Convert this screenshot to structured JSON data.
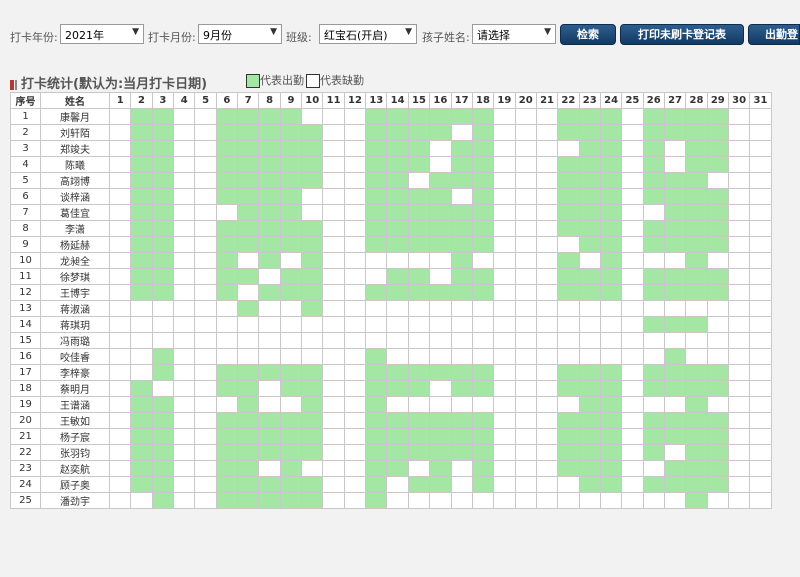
{
  "filters": {
    "year_label": "打卡年份:",
    "year_value": "2021年",
    "month_label": "打卡月份:",
    "month_value": "9月份",
    "class_label": "班级:",
    "class_value": "红宝石(开启)",
    "child_label": "孩子姓名:",
    "child_value": "请选择"
  },
  "buttons": {
    "search": "检索",
    "print": "打印未刷卡登记表",
    "attendance": "出勤登"
  },
  "section": {
    "title": "打卡统计(默认为:当月打卡日期)",
    "legend_present": "代表出勤",
    "legend_absent": "代表缺勤"
  },
  "colors": {
    "present": "#a4e6a4",
    "button": "#1f4a76",
    "title_mark": "#b03a3a"
  },
  "table": {
    "col_index": "序号",
    "col_name": "姓名",
    "days": 31,
    "rows": [
      {
        "no": "1",
        "name": "康馨月",
        "present": [
          2,
          3,
          6,
          7,
          8,
          9,
          13,
          14,
          15,
          16,
          17,
          18,
          22,
          23,
          24,
          26,
          27,
          28,
          29
        ]
      },
      {
        "no": "2",
        "name": "刘轩陌",
        "present": [
          2,
          3,
          6,
          7,
          8,
          9,
          10,
          13,
          14,
          15,
          16,
          18,
          22,
          23,
          24,
          26,
          27,
          28,
          29
        ]
      },
      {
        "no": "3",
        "name": "郑竣夫",
        "present": [
          2,
          3,
          6,
          7,
          8,
          9,
          10,
          13,
          14,
          15,
          17,
          18,
          23,
          24,
          26,
          28,
          29
        ]
      },
      {
        "no": "4",
        "name": "陈曦",
        "present": [
          2,
          3,
          6,
          7,
          8,
          9,
          10,
          13,
          14,
          15,
          17,
          18,
          22,
          23,
          24,
          26,
          28,
          29
        ]
      },
      {
        "no": "5",
        "name": "高翊博",
        "present": [
          2,
          3,
          6,
          7,
          8,
          9,
          10,
          13,
          14,
          16,
          17,
          18,
          22,
          23,
          24,
          26,
          27,
          28
        ]
      },
      {
        "no": "6",
        "name": "谈梓涵",
        "present": [
          2,
          3,
          6,
          7,
          8,
          9,
          13,
          14,
          15,
          16,
          18,
          22,
          23,
          24,
          26,
          27,
          28,
          29
        ]
      },
      {
        "no": "7",
        "name": "葛佳宜",
        "present": [
          2,
          3,
          7,
          8,
          9,
          13,
          14,
          15,
          16,
          17,
          18,
          22,
          23,
          24,
          27,
          28,
          29
        ]
      },
      {
        "no": "8",
        "name": "李潇",
        "present": [
          2,
          3,
          6,
          7,
          8,
          9,
          10,
          13,
          14,
          15,
          16,
          17,
          18,
          22,
          23,
          24,
          26,
          27,
          28,
          29
        ]
      },
      {
        "no": "9",
        "name": "杨延赫",
        "present": [
          2,
          3,
          6,
          7,
          8,
          9,
          10,
          13,
          14,
          15,
          16,
          17,
          18,
          23,
          24,
          26,
          27,
          28,
          29
        ]
      },
      {
        "no": "10",
        "name": "龙昶全",
        "present": [
          2,
          3,
          6,
          8,
          10,
          17,
          22,
          24,
          28
        ]
      },
      {
        "no": "11",
        "name": "徐梦琪",
        "present": [
          2,
          3,
          6,
          7,
          9,
          10,
          14,
          15,
          17,
          18,
          22,
          23,
          24,
          26,
          27,
          28,
          29
        ]
      },
      {
        "no": "12",
        "name": "王博宇",
        "present": [
          2,
          3,
          6,
          8,
          9,
          10,
          13,
          14,
          15,
          16,
          17,
          18,
          22,
          23,
          24,
          26,
          27,
          28,
          29
        ]
      },
      {
        "no": "13",
        "name": "蒋淑涵",
        "present": [
          7,
          10
        ]
      },
      {
        "no": "14",
        "name": "蒋琪玥",
        "present": [
          26,
          27,
          28
        ]
      },
      {
        "no": "15",
        "name": "冯雨璐",
        "present": []
      },
      {
        "no": "16",
        "name": "咬佳睿",
        "present": [
          3,
          13,
          27
        ]
      },
      {
        "no": "17",
        "name": "李梓豪",
        "present": [
          3,
          6,
          7,
          8,
          9,
          10,
          13,
          14,
          15,
          16,
          17,
          18,
          22,
          23,
          24,
          26,
          27,
          28,
          29
        ]
      },
      {
        "no": "18",
        "name": "蔡明月",
        "present": [
          2,
          6,
          7,
          9,
          10,
          13,
          14,
          15,
          17,
          18,
          22,
          23,
          24,
          26,
          27,
          28,
          29
        ]
      },
      {
        "no": "19",
        "name": "王谱涵",
        "present": [
          2,
          3,
          7,
          10,
          13,
          23,
          24,
          28
        ]
      },
      {
        "no": "20",
        "name": "王敏如",
        "present": [
          2,
          3,
          6,
          7,
          8,
          9,
          10,
          13,
          14,
          15,
          16,
          17,
          18,
          22,
          23,
          24,
          26,
          27,
          28,
          29
        ]
      },
      {
        "no": "21",
        "name": "杨子宸",
        "present": [
          2,
          3,
          6,
          7,
          8,
          9,
          10,
          13,
          14,
          15,
          16,
          17,
          18,
          22,
          23,
          24,
          26,
          27,
          28,
          29
        ]
      },
      {
        "no": "22",
        "name": "张羽钧",
        "present": [
          2,
          3,
          6,
          7,
          8,
          9,
          10,
          13,
          14,
          15,
          16,
          17,
          18,
          22,
          23,
          24,
          26,
          28,
          29
        ]
      },
      {
        "no": "23",
        "name": "赵奕航",
        "present": [
          2,
          3,
          6,
          7,
          9,
          13,
          14,
          16,
          18,
          22,
          23,
          24,
          27,
          28,
          29
        ]
      },
      {
        "no": "24",
        "name": "顾子奥",
        "present": [
          2,
          3,
          6,
          7,
          8,
          9,
          10,
          13,
          15,
          16,
          18,
          23,
          24,
          26,
          27,
          28,
          29
        ]
      },
      {
        "no": "25",
        "name": "潘劲宇",
        "present": [
          3,
          6,
          7,
          8,
          9,
          10,
          13,
          28
        ]
      }
    ]
  }
}
